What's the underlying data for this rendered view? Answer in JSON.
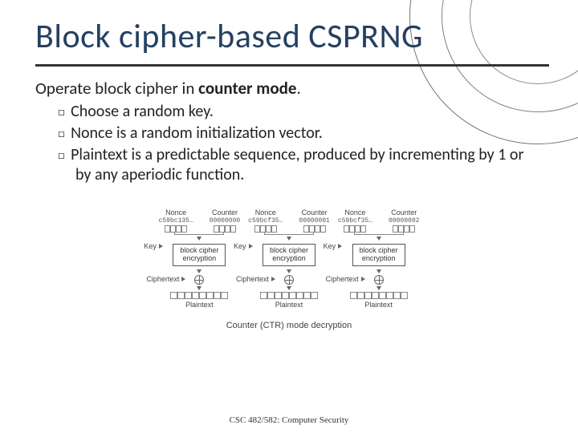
{
  "title": "Block cipher-based CSPRNG",
  "lead_prefix": "Operate block cipher in ",
  "lead_strong": "counter mode",
  "lead_suffix": ".",
  "bullets": [
    "Choose a random key.",
    "Nonce is a random initialization vector.",
    "Plaintext is a predictable sequence, produced by incrementing by 1 or by any aperiodic function."
  ],
  "diagram": {
    "blocks": [
      {
        "nonce": "c59bc135…",
        "counter": "00000000"
      },
      {
        "nonce": "c59bcf35…",
        "counter": "00000001"
      },
      {
        "nonce": "c59bcf35…",
        "counter": "00000002"
      }
    ],
    "labels": {
      "nonce": "Nonce",
      "counter": "Counter",
      "key": "Key",
      "enc_l1": "block cipher",
      "enc_l2": "encryption",
      "ciphertext": "Ciphertext",
      "plaintext": "Plaintext"
    },
    "caption": "Counter (CTR) mode decryption"
  },
  "footer": "CSC 482/582: Computer Security"
}
